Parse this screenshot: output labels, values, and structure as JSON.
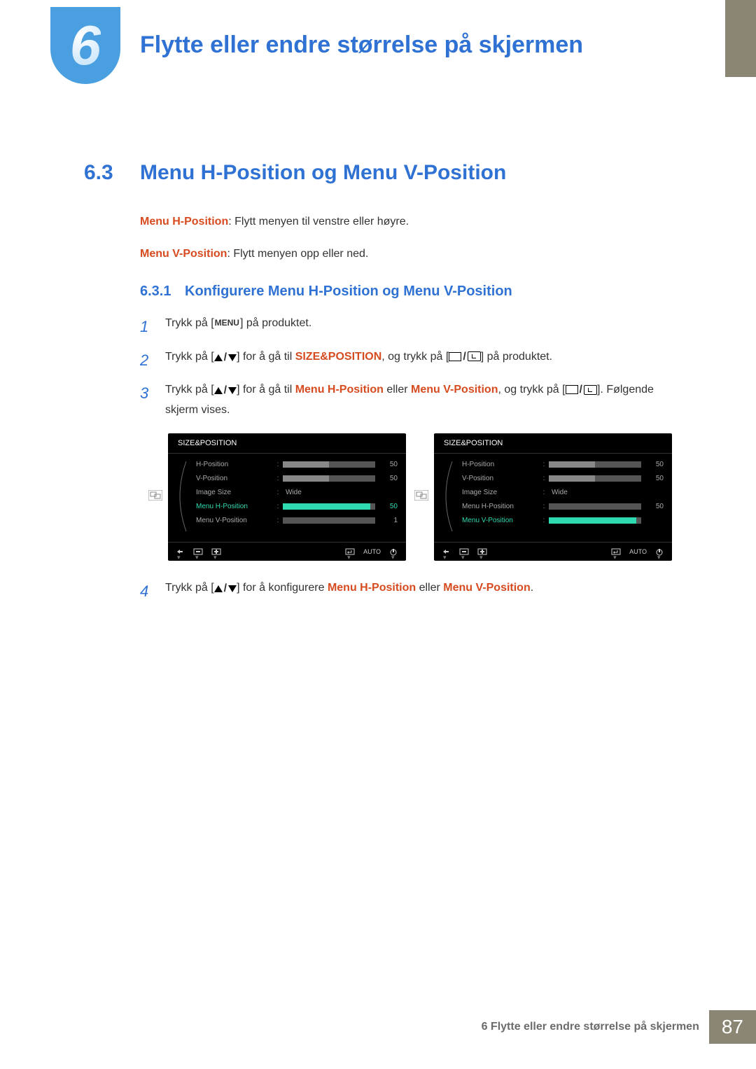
{
  "chapter": {
    "number": "6",
    "title": "Flytte eller endre størrelse på skjermen"
  },
  "section": {
    "number": "6.3",
    "title": "Menu H-Position og Menu V-Position"
  },
  "desc": {
    "h_label": "Menu H-Position",
    "h_text": ": Flytt menyen til venstre eller høyre.",
    "v_label": "Menu V-Position",
    "v_text": ": Flytt menyen opp eller ned."
  },
  "subsection": {
    "number": "6.3.1",
    "title": "Konfigurere Menu H-Position og Menu V-Position"
  },
  "steps": {
    "s1_a": "Trykk på [",
    "s1_menu": "MENU",
    "s1_b": "] på produktet.",
    "s2_a": "Trykk på [",
    "s2_b": "] for å gå til ",
    "s2_target": "SIZE&POSITION",
    "s2_c": ", og trykk på [",
    "s2_d": "] på produktet.",
    "s3_a": "Trykk på [",
    "s3_b": "] for å gå til ",
    "s3_t1": "Menu H-Position",
    "s3_mid": " eller ",
    "s3_t2": "Menu V-Position",
    "s3_c": ", og trykk på [",
    "s3_d": "]. Følgende skjerm vises.",
    "s4_a": "Trykk på [",
    "s4_b": "] for å konfigurere ",
    "s4_t1": "Menu H-Position",
    "s4_mid": " eller ",
    "s4_t2": "Menu V-Position",
    "s4_c": "."
  },
  "osd": {
    "title": "SIZE&POSITION",
    "labels": {
      "hpos": "H-Position",
      "vpos": "V-Position",
      "imgsize": "Image Size",
      "menuh": "Menu H-Position",
      "menuv": "Menu V-Position"
    },
    "wide": "Wide",
    "auto": "AUTO",
    "left": {
      "hpos": "50",
      "vpos": "50",
      "menuh": "50",
      "menuv": "1",
      "highlight": "menuh"
    },
    "right": {
      "hpos": "50",
      "vpos": "50",
      "menuh": "50",
      "menuv": "",
      "highlight": "menuv"
    }
  },
  "footer": {
    "text": "6 Flytte eller endre størrelse på skjermen",
    "page": "87"
  }
}
